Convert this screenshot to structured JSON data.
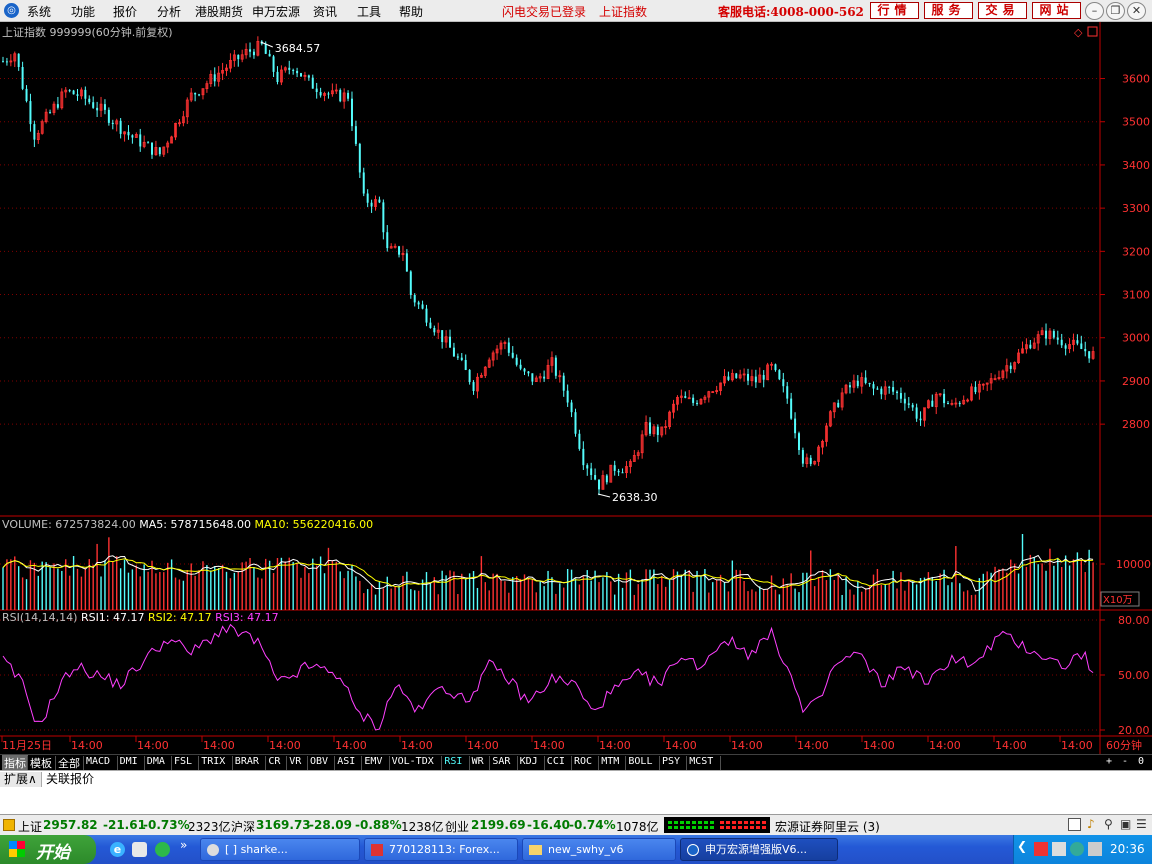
{
  "menu": {
    "items": [
      "系统",
      "功能",
      "报价",
      "分析",
      "港股期货",
      "申万宏源",
      "资讯",
      "工具",
      "帮助"
    ],
    "status_flash": "闪电交易已登录",
    "status_index": "上证指数",
    "hotline": "客服电话:4008-000-562",
    "buttons": [
      "行情",
      "服务",
      "交易",
      "网站"
    ]
  },
  "chart": {
    "title": "上证指数 999999(60分钟.前复权)",
    "high_label": "3684.57",
    "low_label": "2638.30",
    "price_ticks": [
      "3600",
      "3500",
      "3400",
      "3300",
      "3200",
      "3100",
      "3000",
      "2900",
      "2800"
    ],
    "volume": {
      "label": "VOLUME:",
      "value": "672573824.00",
      "ma5_label": "MA5:",
      "ma5": "578715648.00",
      "ma10_label": "MA10:",
      "ma10": "556220416.00",
      "tick": "10000",
      "unit": "X10万"
    },
    "rsi": {
      "label": "RSI(14,14,14)",
      "rsi1_label": "RSI1:",
      "rsi1": "47.17",
      "rsi2_label": "RSI2:",
      "rsi2": "47.17",
      "rsi3_label": "RSI3:",
      "rsi3": "47.17",
      "ticks": [
        "80.00",
        "50.00",
        "20.00"
      ]
    },
    "time_first": "11月25日",
    "time_label": "14:00",
    "period": "60分钟",
    "colors": {
      "up": "#ff3232",
      "down": "#54fcfc",
      "grid": "#800000",
      "axis": "#c00000",
      "ma5": "#ffffff",
      "ma10": "#ffff00",
      "rsi": "#ff40ff"
    }
  },
  "indicator_tabs": [
    "指标",
    "模板",
    "全部",
    "MACD",
    "DMI",
    "DMA",
    "FSL",
    "TRIX",
    "BRAR",
    "CR",
    "VR",
    "OBV",
    "ASI",
    "EMV",
    "VOL-TDX",
    "RSI",
    "WR",
    "SAR",
    "KDJ",
    "CCI",
    "ROC",
    "MTM",
    "BOLL",
    "PSY",
    "MCST"
  ],
  "indicator_active": "RSI",
  "indicator_controls": [
    "+",
    "-",
    "0"
  ],
  "ext_tabs": [
    "扩展∧",
    "关联报价"
  ],
  "status": {
    "sh_label": "上证",
    "sh_value": "2957.82",
    "sh_change": "-21.61",
    "sh_pct": "-0.73%",
    "sh_amount": "2323亿",
    "hs_label": "沪深",
    "hs_value": "3169.73",
    "hs_change": "-28.09",
    "hs_pct": "-0.88%",
    "hs_amount": "1238亿",
    "cy_label": "创业",
    "cy_value": "2199.69",
    "cy_change": "-16.40",
    "cy_pct": "-0.74%",
    "cy_amount": "1078亿",
    "server": "宏源证券阿里云 (3)"
  },
  "taskbar": {
    "start": "开始",
    "items": [
      "[          ] sharke...",
      "770128113: Forex...",
      "new_swhy_v6",
      "申万宏源增强版V6..."
    ],
    "clock": "20:36"
  }
}
